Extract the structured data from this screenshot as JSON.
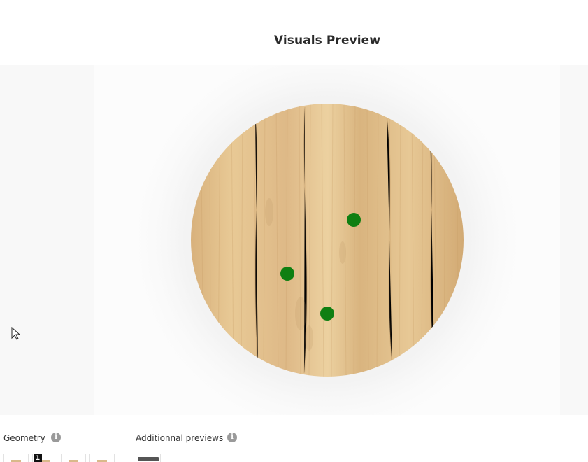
{
  "header": {
    "title": "Visuals Preview"
  },
  "preview": {
    "material": "light oak wood",
    "shape": "round",
    "point_color": "#0f7f12",
    "point_count": 3
  },
  "geometry": {
    "label": "Geometry",
    "info_icon": "info-icon",
    "selected_badge": "1"
  },
  "additional_previews": {
    "label": "Additionnal previews",
    "info_icon": "info-icon"
  },
  "colors": {
    "wood_light": "#ecd3a1",
    "wood_mid": "#ddb884",
    "wood_dark": "#c99f69",
    "marker": "#0f7f12",
    "stage_bg": "#fcfcfc",
    "side_bg": "#f8f8f8"
  }
}
